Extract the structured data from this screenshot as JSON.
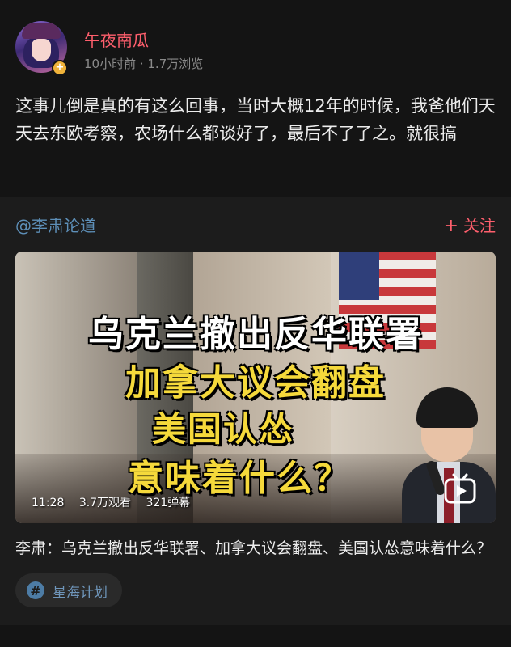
{
  "post": {
    "username": "午夜南瓜",
    "meta": "10小时前 · 1.7万浏览",
    "text": "这事儿倒是真的有这么回事，当时大概12年的时候，我爸他们天天去东欧考察，农场什么都谈好了，最后不了了之。就很搞"
  },
  "card": {
    "source_name": "@李肃论道",
    "follow_plus": "+",
    "follow_label": "关注",
    "video": {
      "headline_1": "乌克兰撤出反华联署",
      "headline_2": "加拿大议会翻盘",
      "headline_3": "美国认怂",
      "headline_4": "意味着什么？",
      "duration": "11:28",
      "views": "3.7万观看",
      "danmaku": "321弹幕"
    },
    "title": "李肃：乌克兰撤出反华联署、加拿大议会翻盘、美国认怂意味着什么？",
    "tag": {
      "icon": "hash-icon",
      "label": "星海计划"
    }
  },
  "colors": {
    "background": "#141414",
    "card_background": "#1c1c1c",
    "username": "#ff5f6d",
    "link_blue": "#5d8fb8",
    "headline_yellow": "#f5d93b"
  }
}
